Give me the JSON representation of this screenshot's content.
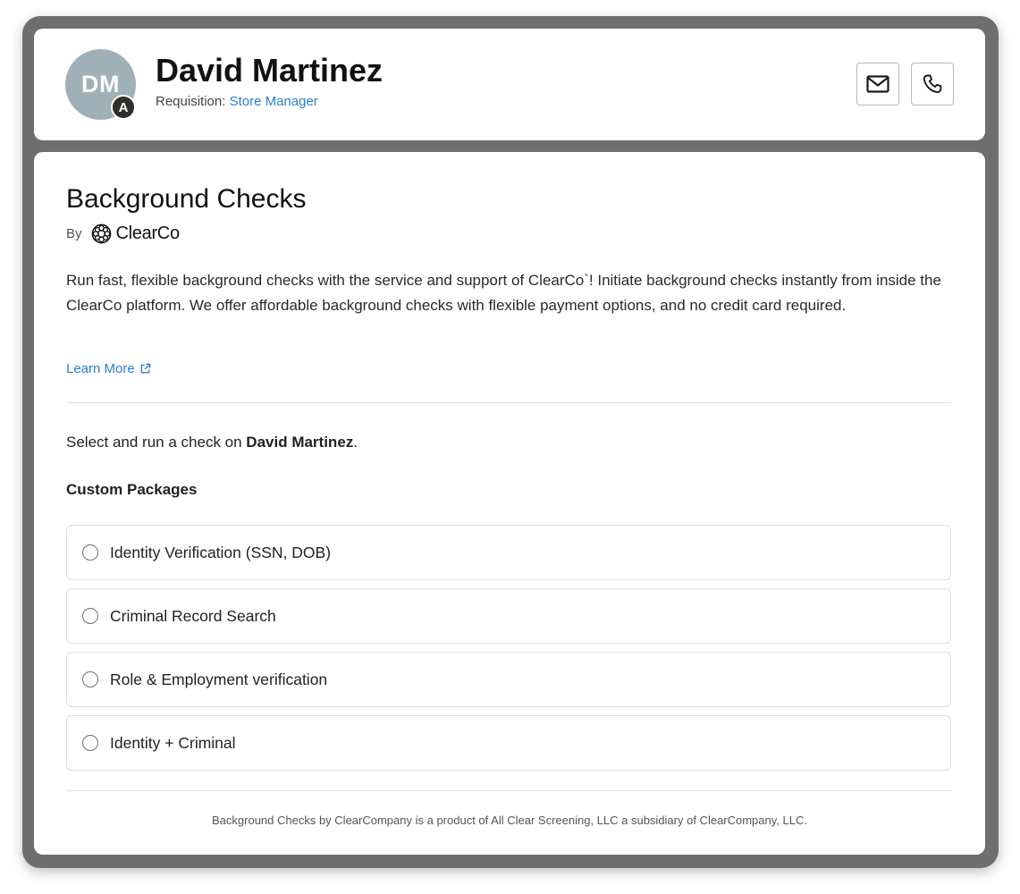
{
  "candidate": {
    "initials": "DM",
    "badge": "A",
    "name": "David Martinez",
    "requisition_label": "Requisition:",
    "requisition_value": "Store Manager"
  },
  "actions": {
    "email_icon": "envelope-icon",
    "phone_icon": "phone-icon"
  },
  "section": {
    "title": "Background Checks",
    "by_label": "By",
    "brand_name": "ClearCo",
    "description": "Run fast, flexible background checks with the service and support of ClearCo`! Initiate background checks instantly from inside the ClearCo platform. We offer affordable background checks with flexible payment options, and no credit card required.",
    "learn_more": "Learn More"
  },
  "selection": {
    "prefix": "Select and run a check on ",
    "name": "David Martinez",
    "suffix": "."
  },
  "packages": {
    "heading": "Custom Packages",
    "items": [
      {
        "label": "Identity Verification (SSN, DOB)"
      },
      {
        "label": "Criminal Record Search"
      },
      {
        "label": "Role & Employment verification"
      },
      {
        "label": "Identity + Criminal"
      }
    ]
  },
  "footer": {
    "note": "Background Checks by ClearCompany is a product of All Clear Screening, LLC a subsidiary of ClearCompany, LLC."
  },
  "colors": {
    "link": "#2a7fd1",
    "frame": "#6e6e6c",
    "avatar": "#9fb0b8"
  }
}
